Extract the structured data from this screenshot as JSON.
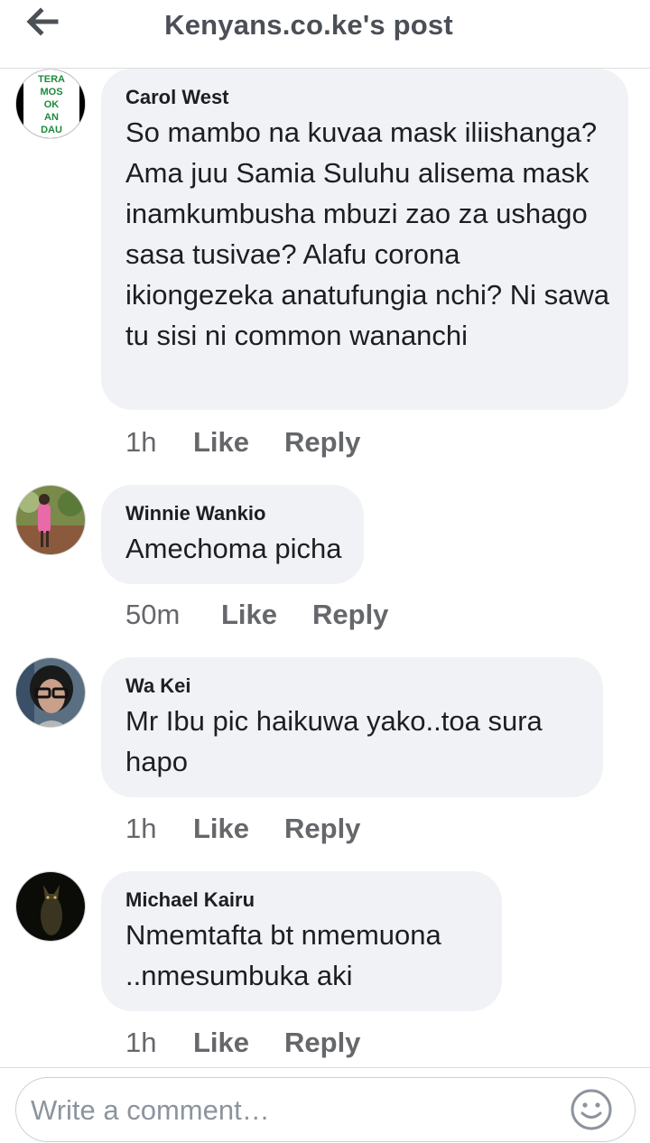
{
  "header": {
    "title": "Kenyans.co.ke's post"
  },
  "comments": [
    {
      "author": "Carol West",
      "text": "So mambo na kuvaa mask iliishanga? Ama juu Samia Suluhu alisema mask inamkumbusha mbuzi zao za ushago sasa tusivae? Alafu corona ikiongezeka anatufungia nchi? Ni sawa tu sisi ni common wananchi",
      "time": "1h",
      "like": "Like",
      "reply": "Reply",
      "avatar_text": [
        "TERA",
        "MOS",
        "OK",
        "AN",
        "DAU"
      ]
    },
    {
      "author": "Winnie Wankio",
      "text": "Amechoma picha",
      "time": "50m",
      "like": "Like",
      "reply": "Reply"
    },
    {
      "author": "Wa Kei",
      "text": "Mr Ibu pic haikuwa yako..toa sura hapo",
      "time": "1h",
      "like": "Like",
      "reply": "Reply"
    },
    {
      "author": "Michael Kairu",
      "text": "Nmemtafta bt nmemuona ..nmesumbuka aki",
      "time": "1h",
      "like": "Like",
      "reply": "Reply"
    }
  ],
  "composer": {
    "placeholder": "Write a comment…"
  },
  "colors": {
    "bubble": "#f0f2f5",
    "meta": "#65676b",
    "title": "#4b4f56"
  }
}
